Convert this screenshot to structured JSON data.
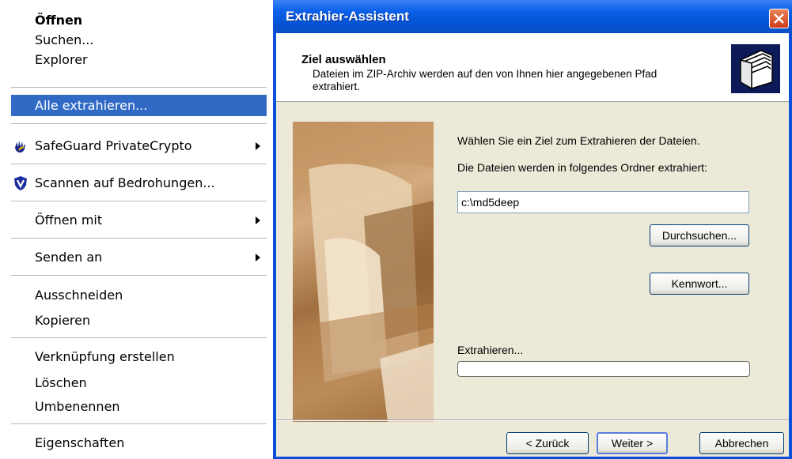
{
  "context_menu": {
    "items": [
      {
        "label": "Öffnen",
        "bold": true
      },
      {
        "label": "Suchen..."
      },
      {
        "label": "Explorer"
      },
      {
        "label": "Alle extrahieren...",
        "highlighted": true
      },
      {
        "label": "SafeGuard PrivateCrypto",
        "icon": "safeguard-hand-icon",
        "submenu": true
      },
      {
        "label": "Scannen auf Bedrohungen...",
        "icon": "shield-icon"
      },
      {
        "label": "Öffnen mit",
        "submenu": true
      },
      {
        "label": "Senden an",
        "submenu": true
      },
      {
        "label": "Ausschneiden"
      },
      {
        "label": "Kopieren"
      },
      {
        "label": "Verknüpfung erstellen"
      },
      {
        "label": "Löschen"
      },
      {
        "label": "Umbenennen"
      },
      {
        "label": "Eigenschaften"
      }
    ]
  },
  "dialog": {
    "title": "Extrahier-Assistent",
    "header_title": "Ziel auswählen",
    "header_description": "Dateien im ZIP-Archiv werden auf den von Ihnen hier angegebenen Pfad extrahiert.",
    "instruction": "Wählen Sie ein Ziel zum Extrahieren der Dateien.",
    "folder_label": "Die Dateien werden in folgendes Ordner extrahiert:",
    "path_value": "c:\\md5deep",
    "browse_label": "Durchsuchen...",
    "password_label": "Kennwort...",
    "progress_label": "Extrahieren...",
    "progress_value": 0,
    "back_label": "< Zurück",
    "next_label": "Weiter >",
    "cancel_label": "Abbrechen"
  },
  "colors": {
    "menu_highlight": "#316ac5",
    "titlebar": "#0a5fe8",
    "dialog_body": "#ece9d8"
  }
}
